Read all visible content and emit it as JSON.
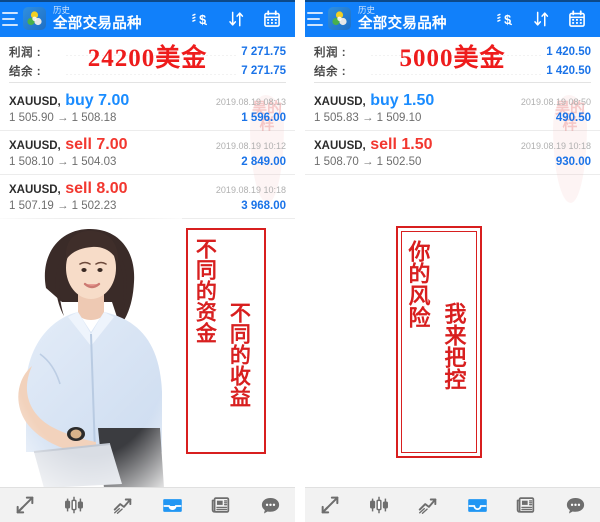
{
  "app": {
    "header": {
      "menu_icon": "hamburger-menu-icon",
      "logo_icon": "app-logo-icon",
      "subtitle": "历史",
      "title": "全部交易品种",
      "icons": [
        {
          "name": "currency-icon",
          "label": "$"
        },
        {
          "name": "sort-icon",
          "label": "↓↑"
        },
        {
          "name": "calendar-icon",
          "label": "calendar"
        }
      ]
    },
    "toolbar": {
      "items": [
        {
          "name": "tab-quotes",
          "icon": "quotes-arrows-icon",
          "active": false
        },
        {
          "name": "tab-charts",
          "icon": "candlestick-icon",
          "active": false
        },
        {
          "name": "tab-trade",
          "icon": "trend-line-icon",
          "active": false
        },
        {
          "name": "tab-history",
          "icon": "inbox-icon",
          "active": true
        },
        {
          "name": "tab-news",
          "icon": "newspaper-icon",
          "active": false
        },
        {
          "name": "tab-chat",
          "icon": "chat-bubble-icon",
          "active": false
        }
      ],
      "active_color": "#2196f3",
      "inactive_color": "#6e6e6e"
    },
    "colors": {
      "header_blue": "#1180fa",
      "value_blue": "#1a73e8",
      "buy_blue": "#1a8cff",
      "sell_red": "#f2372f",
      "annotation_red": "#d81f1f",
      "big_red": "#ee1c1c"
    }
  },
  "panels": [
    {
      "id": "left-panel",
      "summary": {
        "profit_label": "利润 :",
        "profit_value": "7 271.75",
        "balance_label": "结余 :",
        "balance_value": "7 271.75"
      },
      "overlay_amount": "24200美金",
      "seal_text": "昊的样",
      "deals": [
        {
          "symbol": "XAUUSD,",
          "side": "buy",
          "side_label": "buy 7.00",
          "datetime": "2019.08.19 08:13",
          "prices": "1 505.90 → 1 508.18",
          "pnl": "1 596.00"
        },
        {
          "symbol": "XAUUSD,",
          "side": "sell",
          "side_label": "sell 7.00",
          "datetime": "2019.08.19 10:12",
          "prices": "1 508.10 → 1 504.03",
          "pnl": "2 849.00"
        },
        {
          "symbol": "XAUUSD,",
          "side": "sell",
          "side_label": "sell 8.00",
          "datetime": "2019.08.19 10:18",
          "prices": "1 507.19 → 1 502.23",
          "pnl": "3 968.00"
        }
      ],
      "callout": {
        "style": "single",
        "column1": "不同的资金",
        "column2": "不同的收益"
      },
      "photo": "businesswoman-photo"
    },
    {
      "id": "right-panel",
      "summary": {
        "profit_label": "利润 :",
        "profit_value": "1 420.50",
        "balance_label": "结余 :",
        "balance_value": "1 420.50"
      },
      "overlay_amount": "5000美金",
      "seal_text": "昊的样",
      "deals": [
        {
          "symbol": "XAUUSD,",
          "side": "buy",
          "side_label": "buy 1.50",
          "datetime": "2019.08.19 08:50",
          "prices": "1 505.83 → 1 509.10",
          "pnl": "490.50"
        },
        {
          "symbol": "XAUUSD,",
          "side": "sell",
          "side_label": "sell 1.50",
          "datetime": "2019.08.19 10:18",
          "prices": "1 508.70 → 1 502.50",
          "pnl": "930.00"
        }
      ],
      "callout": {
        "style": "double",
        "column1": "你的风险",
        "column2": "我来把控"
      },
      "photo": null
    }
  ]
}
